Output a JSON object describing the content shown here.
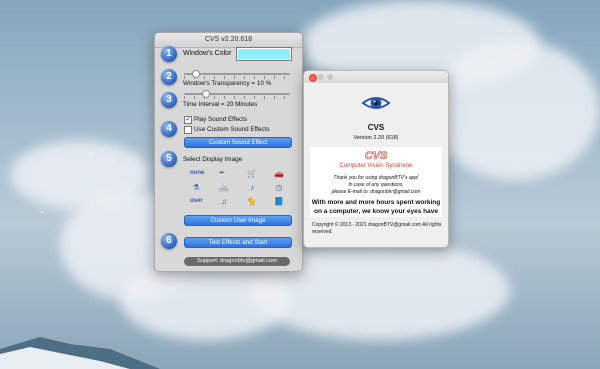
{
  "cvs_window": {
    "title": "CVS v2.20.618",
    "steps": [
      "1",
      "2",
      "3",
      "4",
      "5",
      "6"
    ],
    "window_color_label": "Window's Color",
    "window_color": "#8ef0ff",
    "transparency_label": "Window's Transparency = 10 %",
    "transparency_value": 10,
    "interval_label": "Time Interval = 20 Minutes",
    "interval_value": 20,
    "play_sound_label": "Play Sound Effects",
    "play_sound_checked": true,
    "custom_sound_label": "Use Custom Sound Effects",
    "custom_sound_checked": false,
    "custom_sound_button": "Custom Sound Effect",
    "select_image_label": "Select Display Image",
    "image_options": {
      "none_label": "none",
      "user_label": "user",
      "icons": [
        "cup-icon",
        "cart-icon",
        "car-icon",
        "bottle-icon",
        "bicycle-icon",
        "guitar-icon",
        "clock-icon",
        "headphones-icon",
        "cat-icon",
        "book-icon"
      ]
    },
    "custom_image_button": "Custom User Image",
    "test_button": "Test Effects and Start",
    "support_text": "Support:  dragonbtv@gmail.com"
  },
  "about_window": {
    "app_name": "CVS",
    "version": "Version 2.20 (618)",
    "logo_text": "CVS",
    "subtitle": "Computer Vision Syndrome",
    "thanks": "Thank you for using dragonBTV's app!",
    "questions": "In case of any questions,",
    "email": "please E-mail to: dragonbtv@gmail.com",
    "description_1": "With more and more hours spent working",
    "description_2": "on a computer, we know your eyes have",
    "copyright": "Copyright © 2013 - 2021 dragonBTV@gmail.com All rights reserved.",
    "colors": {
      "logo_red": "#c0392b",
      "subtitle_red": "#d0402f"
    }
  }
}
